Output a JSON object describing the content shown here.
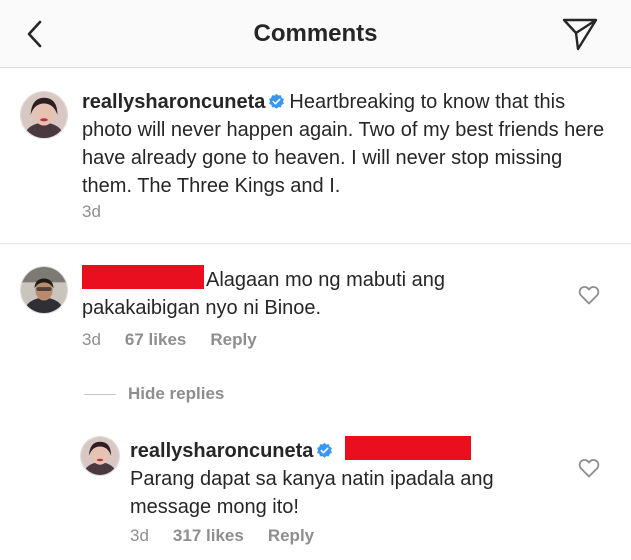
{
  "header": {
    "title": "Comments"
  },
  "caption": {
    "username": "reallysharoncuneta",
    "text": "Heartbreaking to know that this photo will never happen again. Two of my best friends here have already gone to heaven. I will never stop missing them. The Three Kings and I.",
    "time": "3d"
  },
  "comment": {
    "text": "Alagaan mo ng mabuti ang pakakaibigan nyo ni Binoe.",
    "time": "3d",
    "likes": "67 likes",
    "reply_label": "Reply"
  },
  "hide_replies_label": "Hide replies",
  "reply": {
    "username": "reallysharoncuneta",
    "text": "Parang dapat sa kanya natin ipadala ang message mong ito!",
    "time": "3d",
    "likes": "317 likes",
    "reply_label": "Reply"
  },
  "icons": {
    "back": "chevron-left-icon",
    "send": "paper-plane-icon",
    "verified": "verified-badge-icon",
    "like": "heart-outline-icon"
  },
  "colors": {
    "verified": "#3897f0",
    "redaction": "#ea0f1f",
    "secondary_text": "#8e8e8e"
  }
}
